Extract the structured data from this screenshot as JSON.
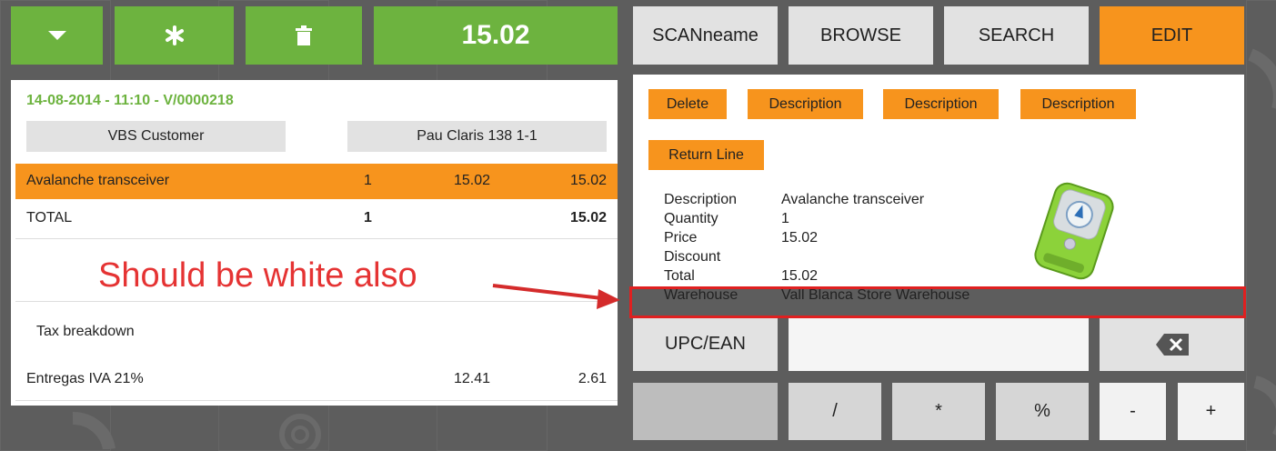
{
  "toolbar": {
    "total": "15.02",
    "colors": {
      "green": "#6db33f",
      "orange": "#f7941d",
      "gray": "#e2e2e2"
    }
  },
  "tabs": {
    "scan": "SCANneame",
    "browse": "BROWSE",
    "search": "SEARCH",
    "edit": "EDIT"
  },
  "ticket": {
    "header": "14-08-2014 - 11:10 - V/0000218",
    "customer": "VBS Customer",
    "address": "Pau Claris 138 1-1",
    "lines": [
      {
        "name": "Avalanche transceiver",
        "qty": "1",
        "price": "15.02",
        "total": "15.02"
      }
    ],
    "total_label": "TOTAL",
    "total_qty": "1",
    "total_amount": "15.02",
    "tax_title": "Tax breakdown",
    "tax_lines": [
      {
        "name": "Entregas IVA 21%",
        "base": "12.41",
        "amount": "2.61"
      }
    ]
  },
  "edit": {
    "buttons": [
      "Delete",
      "Description",
      "Description",
      "Description"
    ],
    "return_line": "Return Line",
    "details": {
      "description_label": "Description",
      "description_value": "Avalanche transceiver",
      "quantity_label": "Quantity",
      "quantity_value": "1",
      "price_label": "Price",
      "price_value": "15.02",
      "discount_label": "Discount",
      "discount_value": "",
      "total_label": "Total",
      "total_value": "15.02",
      "warehouse_label": "Warehouse",
      "warehouse_value": "Vall Blanca Store Warehouse"
    },
    "product_image_icon": "avalanche-transceiver-image"
  },
  "keypad": {
    "upc_label": "UPC/EAN",
    "upc_value": "",
    "backspace_icon": "backspace-icon",
    "divide": "/",
    "multiply": "*",
    "percent": "%",
    "minus": "-",
    "plus": "+"
  },
  "annotation": {
    "text": "Should be white also",
    "color": "#e53333"
  }
}
